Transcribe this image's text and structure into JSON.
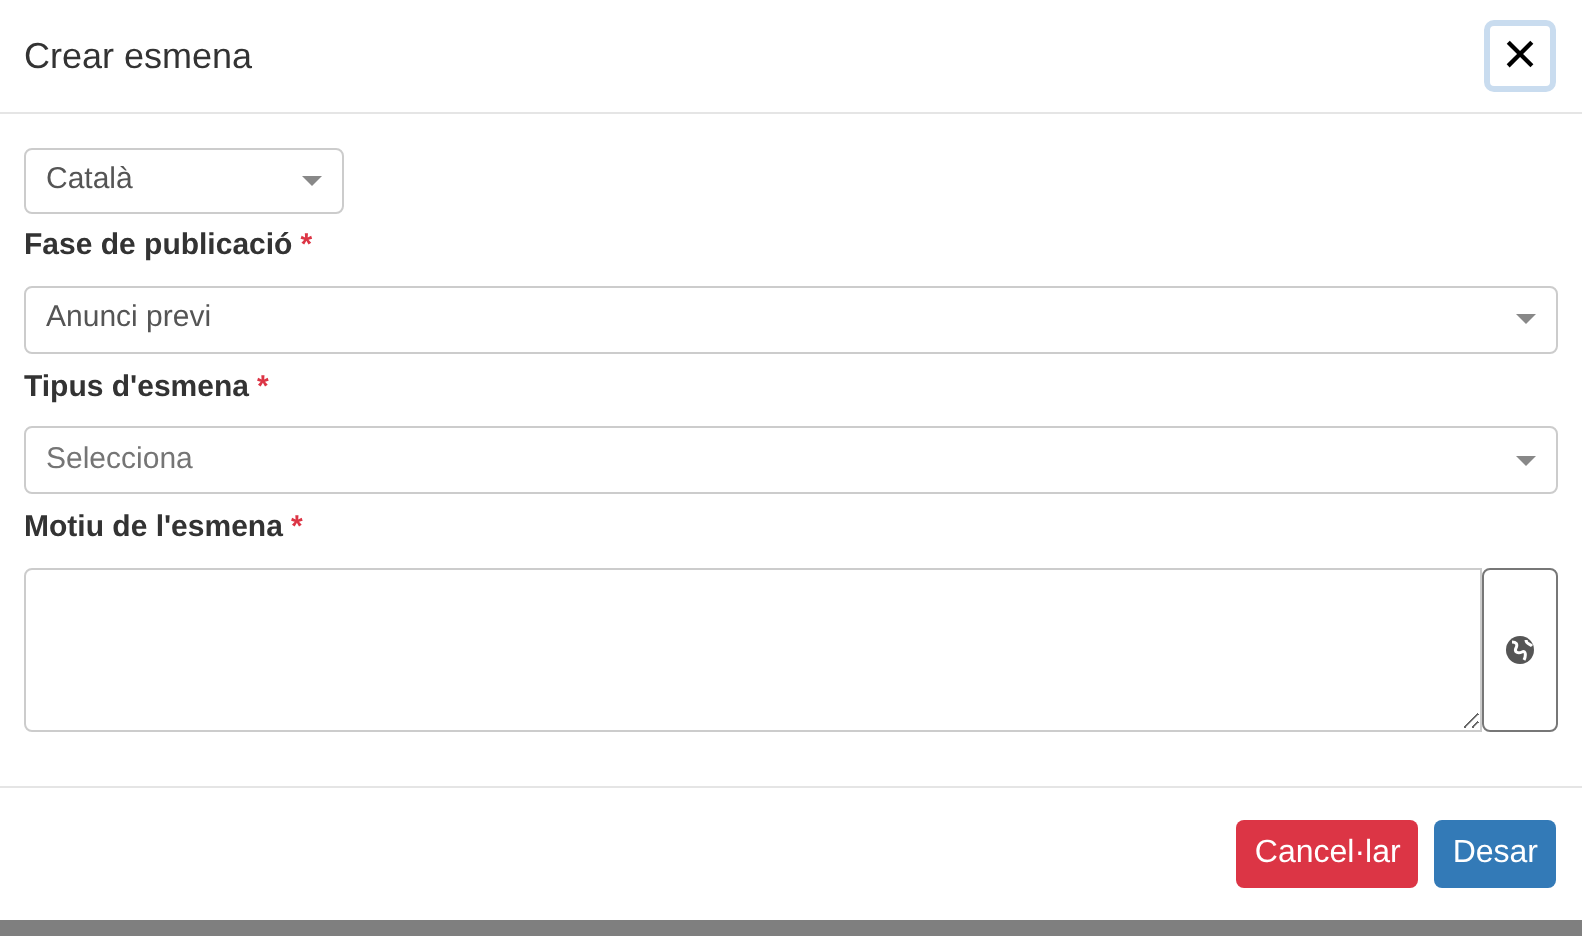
{
  "dialog": {
    "title": "Crear esmena",
    "close_button": "×"
  },
  "language_select": {
    "value": "Català"
  },
  "fields": [
    {
      "kind": "select",
      "label": "Fase de publicació",
      "required_mark": "*",
      "value": "Anunci previ"
    },
    {
      "kind": "select",
      "label": "Tipus d'esmena",
      "required_mark": "*",
      "placeholder": "Selecciona"
    },
    {
      "kind": "textarea",
      "label": "Motiu de l'esmena",
      "required_mark": "*"
    }
  ],
  "buttons": [
    {
      "label": "Cancel·lar",
      "kind": "danger"
    },
    {
      "label": "Desar",
      "kind": "primary"
    }
  ]
}
